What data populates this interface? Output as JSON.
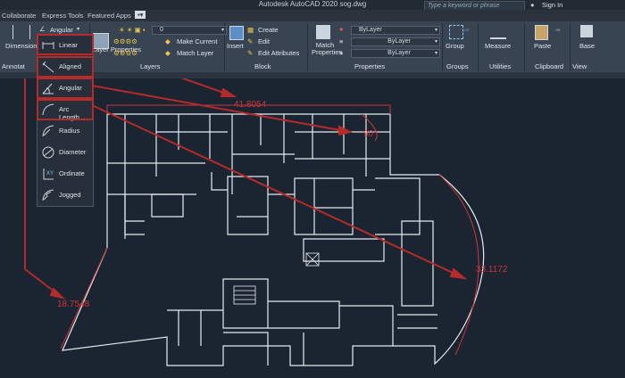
{
  "window": {
    "title": "Autodesk AutoCAD 2020    sog.dwg",
    "search_placeholder": "Type a keyword or phrase",
    "signin": "Sign In"
  },
  "tabs": [
    "Collaborate",
    "Express Tools",
    "Featured Apps"
  ],
  "annotation": {
    "dimension_label": "Dimension",
    "group_label": "Annotat",
    "style_dropdown": "Angular"
  },
  "dim_menu": {
    "items": [
      "Linear",
      "Aligned",
      "Angular",
      "Arc Length",
      "Radius",
      "Diameter",
      "Ordinate",
      "Jogged"
    ]
  },
  "layers": {
    "layer_value": "0",
    "make_current": "Make Current",
    "match_layer": "Match Layer",
    "group_label": "Layers",
    "properties_label": "Layer Properties"
  },
  "block": {
    "insert": "Insert",
    "create": "Create",
    "edit": "Edit",
    "edit_attributes": "Edit Attributes",
    "group_label": "Block"
  },
  "properties": {
    "match_properties": "Match Properties",
    "color_value": "ByLayer",
    "linetype_value": "ByLayer",
    "lineweight_value": "ByLayer",
    "group_label": "Properties"
  },
  "groups": {
    "group_button": "Group",
    "group_label": "Groups"
  },
  "utilities": {
    "measure": "Measure",
    "group_label": "Utilities"
  },
  "clipboard": {
    "paste": "Paste",
    "group_label": "Clipboard"
  },
  "view": {
    "base": "Base",
    "group_label": "View"
  },
  "drawing": {
    "dims": [
      "41.8054",
      "90°",
      "33.1172",
      "18.7548"
    ]
  },
  "colors": {
    "highlight": "#b52a2a",
    "dimension": "#c9363a",
    "canvas": "#1b2431"
  }
}
